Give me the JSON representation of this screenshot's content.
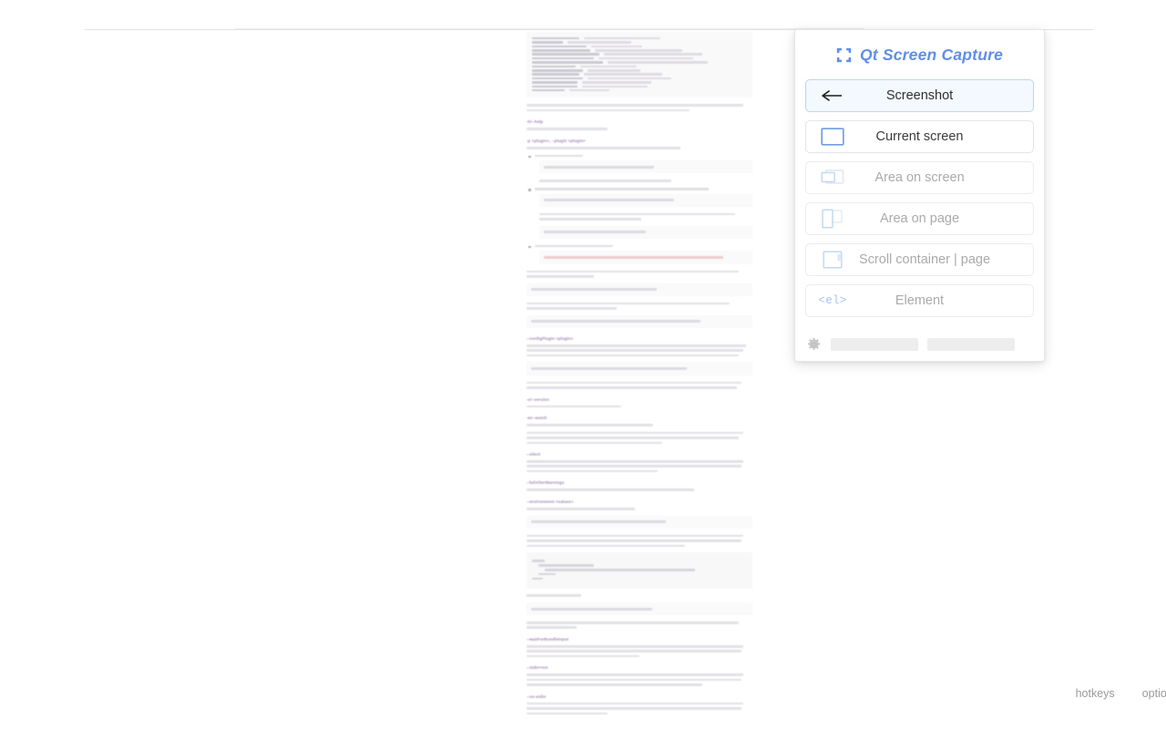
{
  "panel": {
    "title": "Qt Screen Capture",
    "logo_icon": "capture-brackets-icon",
    "buttons": [
      {
        "label": "Screenshot",
        "icon": "back-arrow-icon",
        "state": "active",
        "name": "screenshot-button"
      },
      {
        "label": "Current screen",
        "icon": "screen-rect-icon",
        "state": "enabled",
        "name": "current-screen-button"
      },
      {
        "label": "Area on screen",
        "icon": "area-on-screen-icon",
        "state": "dimmed",
        "name": "area-on-screen-button"
      },
      {
        "label": "Area on page",
        "icon": "area-on-page-icon",
        "state": "dimmed",
        "name": "area-on-page-button"
      },
      {
        "label": "Scroll container | page",
        "icon": "scroll-container-icon",
        "state": "dimmed",
        "name": "scroll-container-button"
      },
      {
        "label": "Element",
        "icon": "element-tag-icon",
        "state": "dimmed",
        "name": "element-button",
        "tag": "<el>"
      }
    ],
    "footer": {
      "settings_icon": "gear-icon",
      "placeholder_left": "",
      "placeholder_right": ""
    },
    "accent_color": "#5f8ee8",
    "active_bg": "#f4f9ff",
    "active_border": "#b9d6f7"
  },
  "page": {
    "corner_links": [
      {
        "label": "hotkeys",
        "name": "hotkeys-link"
      },
      {
        "label": "options",
        "name": "options-link"
      }
    ]
  },
  "document": {
    "description": "Rollup command line flags reference page rendered at reduced scale",
    "sections": [
      {
        "heading": "-h/--help"
      },
      {
        "heading": "-p <plugin>, --plugin <plugin>"
      },
      {
        "heading": "--configPlugin <plugin>"
      },
      {
        "heading": "-v/--version"
      },
      {
        "heading": "-w/--watch"
      },
      {
        "heading": "--silent"
      },
      {
        "heading": "--failAfterWarnings"
      },
      {
        "heading": "--environment <values>"
      },
      {
        "heading": "--waitForBundleInput"
      },
      {
        "heading": "--stdin=ext"
      },
      {
        "heading": "--no-stdin"
      }
    ]
  }
}
